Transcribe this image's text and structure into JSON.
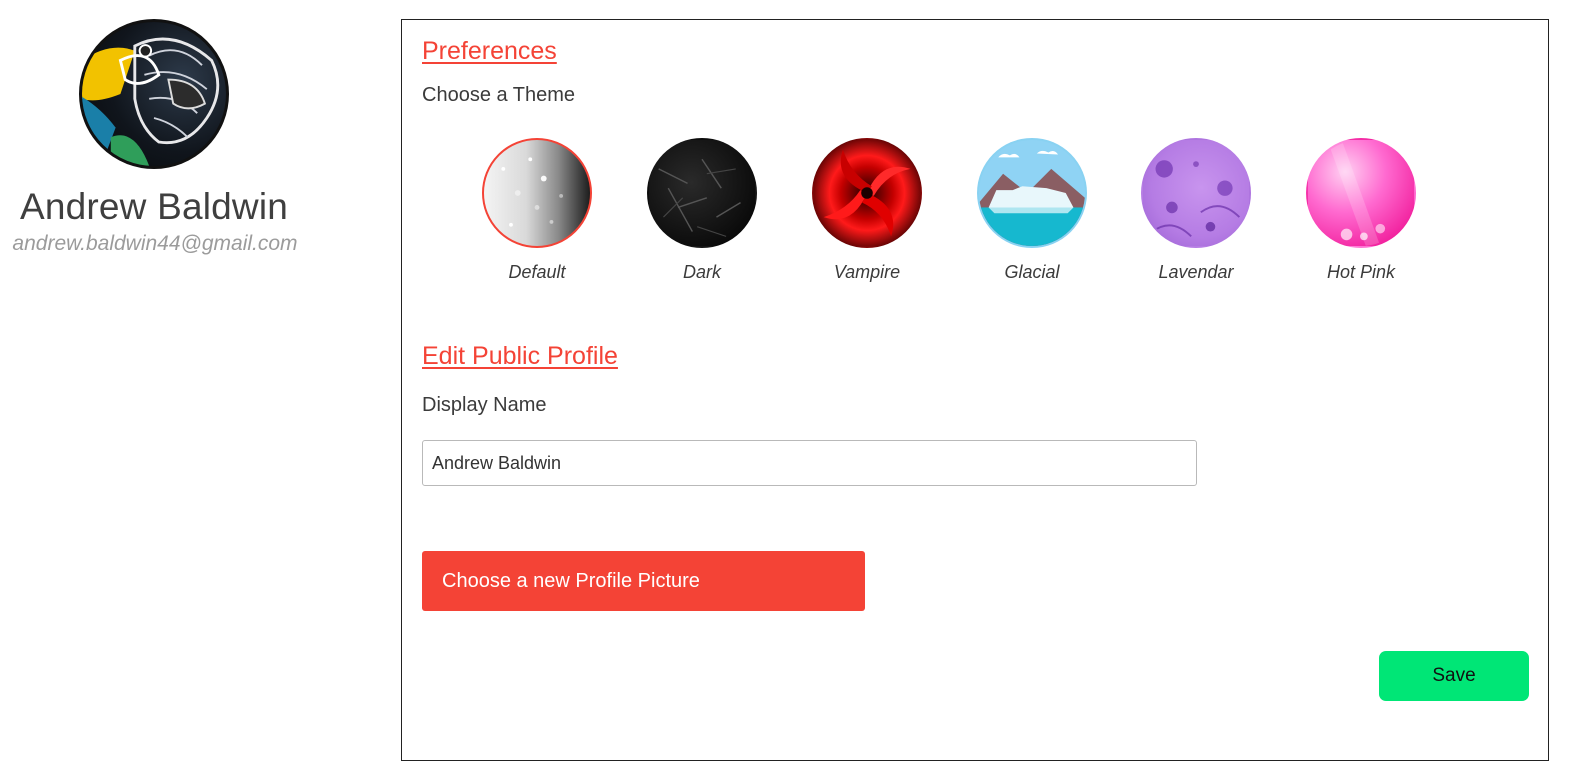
{
  "profile": {
    "name": "Andrew Baldwin",
    "email": "andrew.baldwin44@gmail.com"
  },
  "preferences": {
    "heading": "Preferences",
    "theme_label": "Choose a Theme",
    "selected_theme": "Default",
    "themes": [
      {
        "label": "Default",
        "icon": "default-theme-swatch"
      },
      {
        "label": "Dark",
        "icon": "dark-theme-swatch"
      },
      {
        "label": "Vampire",
        "icon": "vampire-theme-swatch"
      },
      {
        "label": "Glacial",
        "icon": "glacial-theme-swatch"
      },
      {
        "label": "Lavendar",
        "icon": "lavendar-theme-swatch"
      },
      {
        "label": "Hot Pink",
        "icon": "hot-pink-theme-swatch"
      }
    ]
  },
  "public_profile": {
    "heading": "Edit Public Profile",
    "display_name_label": "Display Name",
    "display_name_value": "Andrew Baldwin",
    "picture_button_label": "Choose a new Profile Picture"
  },
  "actions": {
    "save_label": "Save"
  },
  "colors": {
    "accent": "#f44336",
    "save": "#00e676",
    "selected_border": "#f44336"
  }
}
